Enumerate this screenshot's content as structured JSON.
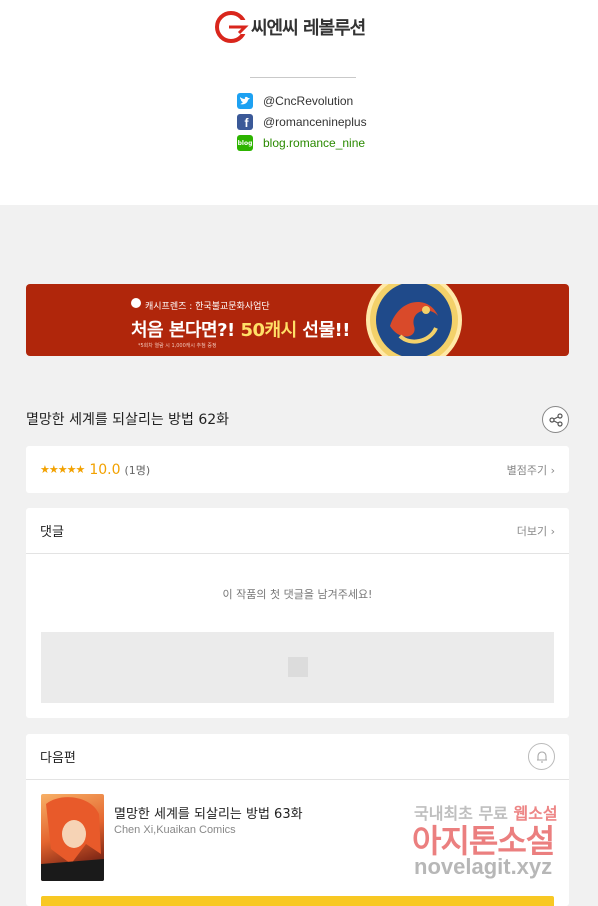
{
  "header": {
    "logo_text": "씨엔씨 레볼루션",
    "social": [
      {
        "icon": "twitter-icon",
        "text": "@CncRevolution",
        "color": "#1da1f2"
      },
      {
        "icon": "facebook-icon",
        "text": "@romancenineplus",
        "color": "#3b5998"
      },
      {
        "icon": "blog-icon",
        "text": "blog.romance_nine",
        "color": "#2db400"
      }
    ]
  },
  "banner": {
    "sub": "캐시프렌즈 : 한국불교문화사업단",
    "main_prefix": "처음 본다면?! ",
    "main_highlight": "50캐시",
    "main_suffix": " 선물!!",
    "fine": "*5회차 열람 시 1,000캐시 추첨 증정"
  },
  "episode": {
    "title": "멸망한 세계를 되살리는 방법 62화"
  },
  "rating": {
    "stars": "★★★★★",
    "score": "10.0",
    "count": "(1명)",
    "rate_label": "별점주기 ›"
  },
  "comments": {
    "heading": "댓글",
    "more_label": "더보기 ›",
    "empty_message": "이 작품의 첫 댓글을 남겨주세요!"
  },
  "next": {
    "heading": "다음편",
    "title": "멸망한 세계를 되살리는 방법 63화",
    "author": "Chen Xi,Kuaikan Comics"
  },
  "watermark": {
    "line1_a": "국내최초 무료 ",
    "line1_b": "웹소설",
    "line2": "아지톤소설",
    "line3": "novelagit.xyz"
  }
}
